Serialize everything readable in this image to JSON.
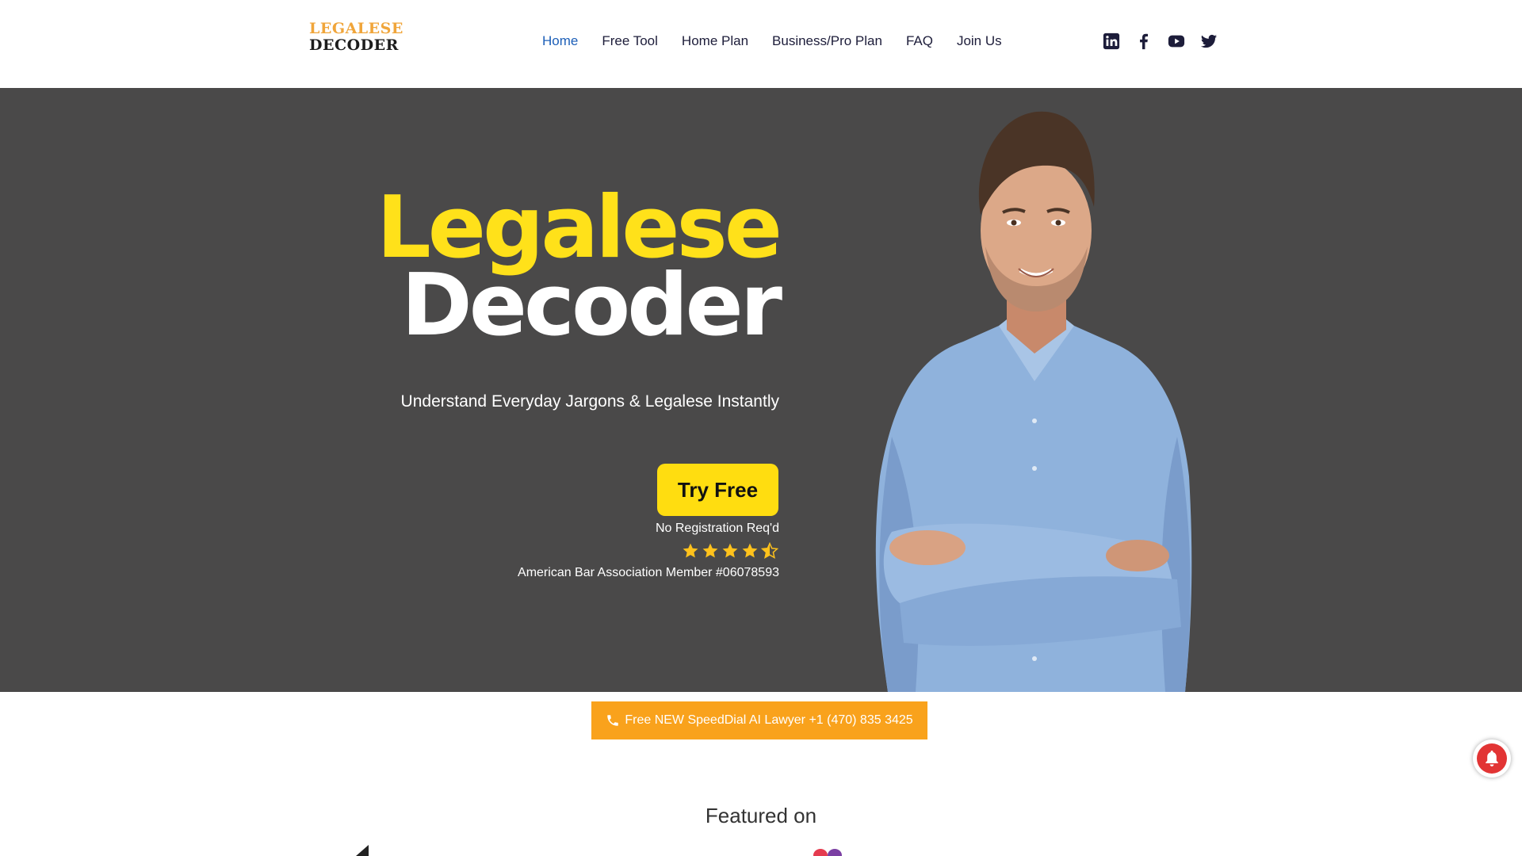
{
  "logo": {
    "line1": "LEGALESE",
    "line2": "DECODER"
  },
  "nav": [
    {
      "label": "Home",
      "active": true
    },
    {
      "label": "Free Tool"
    },
    {
      "label": "Home Plan"
    },
    {
      "label": "Business/Pro Plan"
    },
    {
      "label": "FAQ"
    },
    {
      "label": "Join Us"
    }
  ],
  "social": [
    "linkedin-icon",
    "facebook-icon",
    "youtube-icon",
    "twitter-icon"
  ],
  "hero": {
    "title_line1": "Legalese",
    "title_line2": "Decoder",
    "subtitle": "Understand Everyday Jargons & Legalese Instantly",
    "cta_label": "Try Free",
    "no_registration": "No Registration Req'd",
    "rating": 4.5,
    "member_text": "American Bar Association Member #06078593"
  },
  "speeddial": {
    "label": "Free NEW SpeedDial AI Lawyer +1 (470) 835 3425"
  },
  "featured": {
    "heading": "Featured on"
  },
  "colors": {
    "accent_yellow": "#ffe11a",
    "hero_bg": "#4a4949",
    "orange": "#f9a21c",
    "nav_active": "#1d5fb8",
    "bell_red": "#e23434"
  }
}
